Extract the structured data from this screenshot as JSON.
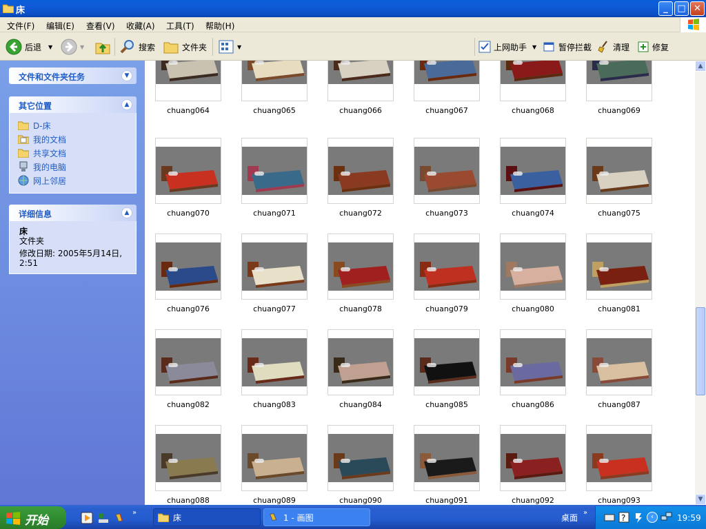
{
  "window": {
    "title": "床"
  },
  "menu": [
    "文件(F)",
    "编辑(E)",
    "查看(V)",
    "收藏(A)",
    "工具(T)",
    "帮助(H)"
  ],
  "toolbar": {
    "back": "后退",
    "search": "搜索",
    "folders": "文件夹",
    "online_helper": "上网助手",
    "pause_block": "暂停拦截",
    "clean": "清理",
    "repair": "修复"
  },
  "sidebar": {
    "tasks_title": "文件和文件夹任务",
    "places_title": "其它位置",
    "places": [
      "D-床",
      "我的文档",
      "共享文档",
      "我的电脑",
      "网上邻居"
    ],
    "details_title": "详细信息",
    "detail_name": "床",
    "detail_type": "文件夹",
    "detail_modified_1": "修改日期: 2005年5月14日,",
    "detail_modified_2": "2:51"
  },
  "files": [
    "chuang064",
    "chuang065",
    "chuang066",
    "chuang067",
    "chuang068",
    "chuang069",
    "chuang070",
    "chuang071",
    "chuang072",
    "chuang073",
    "chuang074",
    "chuang075",
    "chuang076",
    "chuang077",
    "chuang078",
    "chuang079",
    "chuang080",
    "chuang081",
    "chuang082",
    "chuang083",
    "chuang084",
    "chuang085",
    "chuang086",
    "chuang087",
    "chuang088",
    "chuang089",
    "chuang090",
    "chuang091",
    "chuang092",
    "chuang093"
  ],
  "taskbar": {
    "start": "开始",
    "task_explorer": "床",
    "task_paint": "1 - 画图",
    "desktop": "桌面",
    "clock": "19:59"
  },
  "colors": {
    "accent": "#215dc6",
    "titlebar": "#0b4fc6",
    "start": "#2f8a2f",
    "thumb_bg": "#7a7a7a"
  }
}
